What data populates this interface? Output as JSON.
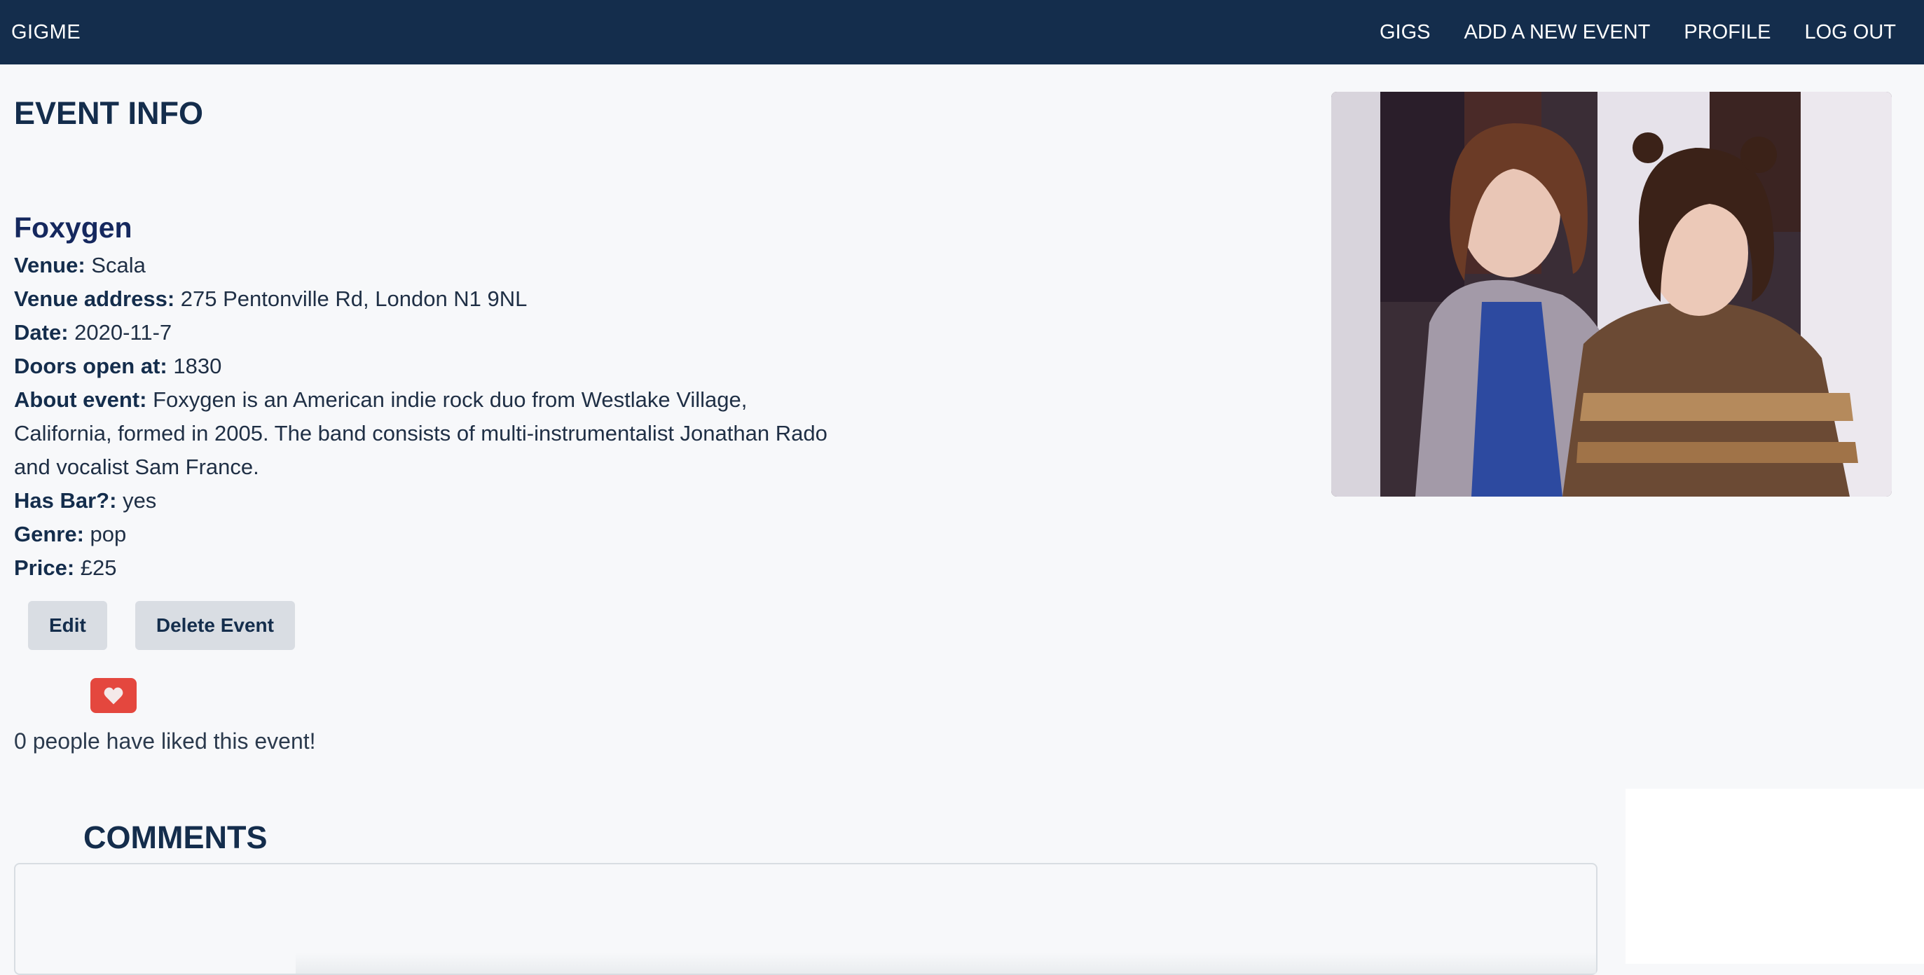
{
  "nav": {
    "brand": "GIGME",
    "links": [
      "GIGS",
      "ADD A NEW EVENT",
      "PROFILE",
      "LOG OUT"
    ]
  },
  "page": {
    "heading": "EVENT INFO"
  },
  "event": {
    "title": "Foxygen",
    "fields": [
      {
        "label": "Venue:",
        "value": "Scala"
      },
      {
        "label": "Venue address:",
        "value": "275 Pentonville Rd, London N1 9NL"
      },
      {
        "label": "Date:",
        "value": "2020-11-7"
      },
      {
        "label": "Doors open at:",
        "value": "1830"
      },
      {
        "label": "About event:",
        "value": "Foxygen is an American indie rock duo from Westlake Village, California, formed in 2005. The band consists of multi-instrumentalist Jonathan Rado and vocalist Sam France."
      },
      {
        "label": "Has Bar?:",
        "value": "yes"
      },
      {
        "label": "Genre:",
        "value": "pop"
      },
      {
        "label": "Price:",
        "value": "£25"
      }
    ]
  },
  "actions": {
    "edit_label": "Edit",
    "delete_label": "Delete Event"
  },
  "likes": {
    "icon": "heart-icon",
    "count_text": "0 people have liked this event!"
  },
  "comments": {
    "heading": "COMMENTS"
  },
  "colors": {
    "navbar": "#142d4c",
    "heading": "#142d4c",
    "like_button": "#e4473e",
    "button_bg": "#d9dde3",
    "page_bg": "#f7f8fa"
  }
}
